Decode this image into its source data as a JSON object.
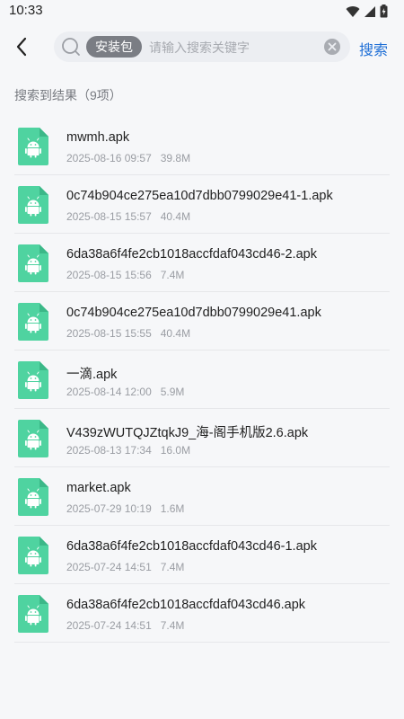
{
  "status_bar": {
    "time": "10:33"
  },
  "toolbar": {
    "search_chip": "安装包",
    "search_placeholder": "请输入搜索关键字",
    "search_button": "搜索"
  },
  "results": {
    "title": "搜索到结果（9项）",
    "items": [
      {
        "name": "mwmh.apk",
        "date": "2025-08-16 09:57",
        "size": "39.8M"
      },
      {
        "name": "0c74b904ce275ea10d7dbb0799029e41-1.apk",
        "date": "2025-08-15 15:57",
        "size": "40.4M"
      },
      {
        "name": "6da38a6f4fe2cb1018accfdaf043cd46-2.apk",
        "date": "2025-08-15 15:56",
        "size": "7.4M"
      },
      {
        "name": "0c74b904ce275ea10d7dbb0799029e41.apk",
        "date": "2025-08-15 15:55",
        "size": "40.4M"
      },
      {
        "name": "一滴.apk",
        "date": "2025-08-14 12:00",
        "size": "5.9M"
      },
      {
        "name": "V439zWUTQJZtqkJ9_海-阁手机版2.6.apk",
        "date": "2025-08-13 17:34",
        "size": "16.0M"
      },
      {
        "name": "market.apk",
        "date": "2025-07-29 10:19",
        "size": "1.6M"
      },
      {
        "name": "6da38a6f4fe2cb1018accfdaf043cd46-1.apk",
        "date": "2025-07-24 14:51",
        "size": "7.4M"
      },
      {
        "name": "6da38a6f4fe2cb1018accfdaf043cd46.apk",
        "date": "2025-07-24 14:51",
        "size": "7.4M"
      }
    ]
  },
  "colors": {
    "accent": "#1f6fd6",
    "apk_icon": "#4fd3a0",
    "chip": "#7a7d84"
  },
  "icons": {
    "file": "android-apk-icon",
    "back": "back-arrow-icon",
    "search": "search-icon",
    "clear": "clear-icon"
  }
}
